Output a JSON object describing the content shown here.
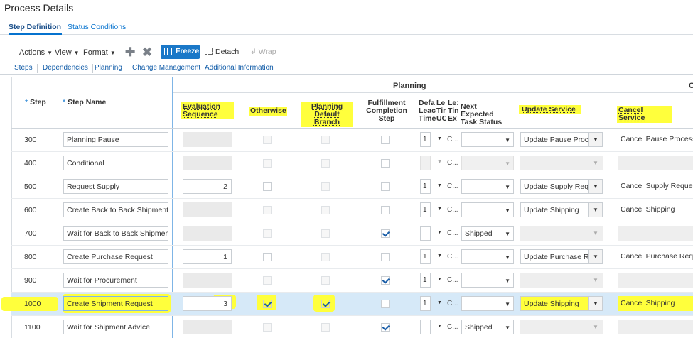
{
  "page_title": "Process Details",
  "tabs": [
    {
      "label": "Step Definition",
      "active": true
    },
    {
      "label": "Status Conditions",
      "active": false
    }
  ],
  "toolbar": {
    "actions_label": "Actions",
    "view_label": "View",
    "format_label": "Format",
    "add_icon": "plus-icon",
    "delete_icon": "x-icon",
    "freeze_label": "Freeze",
    "detach_label": "Detach",
    "wrap_label": "Wrap"
  },
  "subtabs": [
    "Steps",
    "Dependencies",
    "Planning",
    "Change Management",
    "Additional Information"
  ],
  "headers": {
    "group_planning": "Planning",
    "group_next": "C",
    "step": "Step",
    "step_name": "Step Name",
    "evaluation_sequence_1": "Evaluation",
    "evaluation_sequence_2": "Sequence",
    "otherwise": "Otherwise",
    "planning_default_branch_1": "Planning",
    "planning_default_branch_2": "Default Branch",
    "fulfillment_1": "Fulfillment",
    "fulfillment_2": "Completion",
    "fulfillment_3": "Step",
    "default_lead_1": "Defa",
    "default_lead_2": "Leac",
    "default_lead_3": "Time",
    "lead_uom_1": "Le:",
    "lead_uom_2": "Tin",
    "lead_uom_3": "UC",
    "lead_ex_1": "Le:",
    "lead_ex_2": "Tin",
    "lead_ex_3": "Ex",
    "next_expected_1": "Next Expected",
    "next_expected_2": "Task Status",
    "update_service": "Update Service",
    "cancel_service": "Cancel Service"
  },
  "highlight_color": "#ffff3c",
  "selected_row_color": "#d6e9f8",
  "accent_color": "#1a78c8",
  "rows": [
    {
      "step": "300",
      "name": "Planning Pause",
      "eval": "",
      "eval_editable": false,
      "otherwise": false,
      "otherwise_enabled": false,
      "pdb": false,
      "pdb_enabled": false,
      "fulfill": false,
      "lead": "1",
      "lead_empty": false,
      "c": "C...",
      "next_status": "",
      "next_enabled": true,
      "update": "Update Pause Process",
      "update_enabled": true,
      "cancel": "Cancel Pause Process",
      "selected": false
    },
    {
      "step": "400",
      "name": "Conditional",
      "eval": "",
      "eval_editable": false,
      "otherwise": false,
      "otherwise_enabled": false,
      "pdb": false,
      "pdb_enabled": false,
      "fulfill": false,
      "lead": "",
      "lead_empty": true,
      "c": "C...",
      "next_status": "",
      "next_enabled": false,
      "update": "",
      "update_enabled": false,
      "cancel": "",
      "selected": false
    },
    {
      "step": "500",
      "name": "Request Supply",
      "eval": "2",
      "eval_editable": true,
      "otherwise": false,
      "otherwise_enabled": true,
      "pdb": false,
      "pdb_enabled": false,
      "fulfill": false,
      "lead": "1",
      "lead_empty": false,
      "c": "C...",
      "next_status": "",
      "next_enabled": true,
      "update": "Update Supply Request",
      "update_enabled": true,
      "cancel": "Cancel Supply Request",
      "selected": false
    },
    {
      "step": "600",
      "name": "Create Back to Back Shipment Request",
      "eval": "",
      "eval_editable": false,
      "otherwise": false,
      "otherwise_enabled": false,
      "pdb": false,
      "pdb_enabled": false,
      "fulfill": false,
      "lead": "1",
      "lead_empty": false,
      "c": "C...",
      "next_status": "",
      "next_enabled": true,
      "update": "Update Shipping",
      "update_enabled": true,
      "cancel": "Cancel Shipping",
      "selected": false
    },
    {
      "step": "700",
      "name": "Wait for Back to Back Shipment Advice",
      "eval": "",
      "eval_editable": false,
      "otherwise": false,
      "otherwise_enabled": false,
      "pdb": false,
      "pdb_enabled": false,
      "fulfill": true,
      "lead": "",
      "lead_empty": false,
      "c": "C...",
      "next_status": "Shipped",
      "next_enabled": true,
      "update": "",
      "update_enabled": false,
      "cancel": "",
      "selected": false
    },
    {
      "step": "800",
      "name": "Create Purchase Request",
      "eval": "1",
      "eval_editable": true,
      "otherwise": false,
      "otherwise_enabled": true,
      "pdb": false,
      "pdb_enabled": false,
      "fulfill": false,
      "lead": "1",
      "lead_empty": false,
      "c": "C...",
      "next_status": "",
      "next_enabled": true,
      "update": "Update Purchase Request",
      "update_enabled": true,
      "cancel": "Cancel Purchase Request",
      "selected": false
    },
    {
      "step": "900",
      "name": "Wait for Procurement",
      "eval": "",
      "eval_editable": false,
      "otherwise": false,
      "otherwise_enabled": false,
      "pdb": false,
      "pdb_enabled": false,
      "fulfill": true,
      "lead": "1",
      "lead_empty": false,
      "c": "C...",
      "next_status": "",
      "next_enabled": true,
      "update": "",
      "update_enabled": false,
      "cancel": "",
      "selected": false
    },
    {
      "step": "1000",
      "name": "Create Shipment Request",
      "eval": "3",
      "eval_editable": true,
      "otherwise": true,
      "otherwise_enabled": true,
      "pdb": true,
      "pdb_enabled": true,
      "fulfill": false,
      "lead": "1",
      "lead_empty": false,
      "c": "C...",
      "next_status": "",
      "next_enabled": true,
      "update": "Update Shipping",
      "update_enabled": true,
      "cancel": "Cancel Shipping",
      "selected": true
    },
    {
      "step": "1100",
      "name": "Wait for Shipment Advice",
      "eval": "",
      "eval_editable": false,
      "otherwise": false,
      "otherwise_enabled": false,
      "pdb": false,
      "pdb_enabled": false,
      "fulfill": true,
      "lead": "",
      "lead_empty": false,
      "c": "C...",
      "next_status": "Shipped",
      "next_enabled": true,
      "update": "",
      "update_enabled": false,
      "cancel": "",
      "selected": false
    }
  ]
}
